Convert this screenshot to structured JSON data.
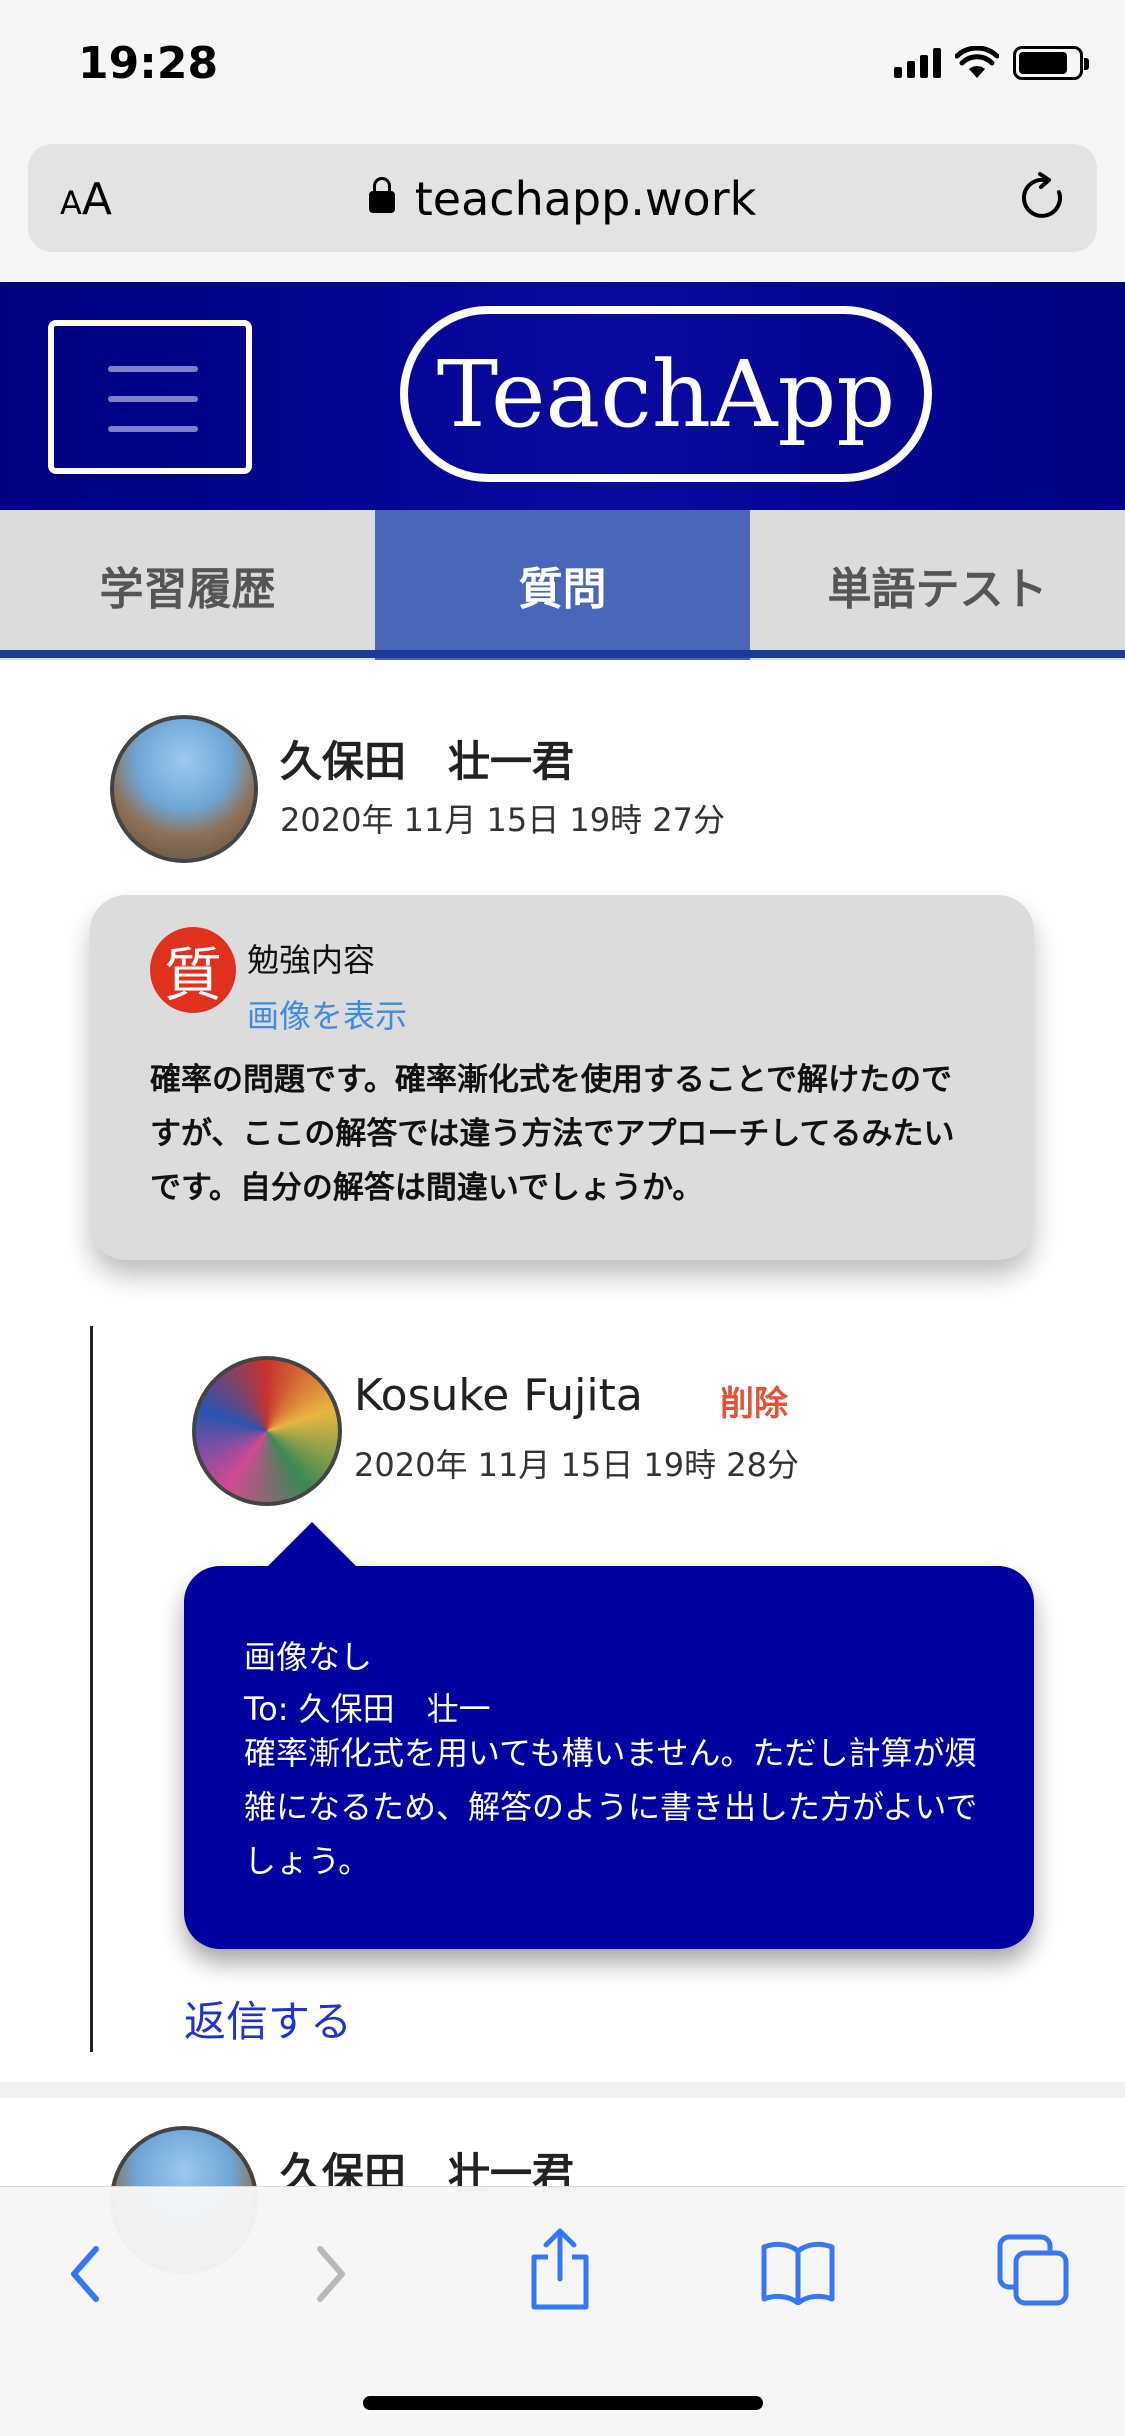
{
  "status_bar": {
    "time": "19:28"
  },
  "browser": {
    "text_size_label": "AA",
    "url": "teachapp.work"
  },
  "header": {
    "logo": "TeachApp"
  },
  "tabs": [
    {
      "label": "学習履歴",
      "active": false
    },
    {
      "label": "質問",
      "active": true
    },
    {
      "label": "単語テスト",
      "active": false
    }
  ],
  "question": {
    "author": "久保田　壮一君",
    "date": "2020年 11月 15日 19時 27分",
    "mark": "質",
    "subject": "勉強内容",
    "image_link": "画像を表示",
    "body": "確率の問題です。確率漸化式を使用することで解けたのですが、ここの解答では違う方法でアプローチしてるみたいです。自分の解答は間違いでしょうか。"
  },
  "reply": {
    "author": "Kosuke Fujita",
    "delete_label": "削除",
    "date": "2020年 11月 15日 19時 28分",
    "image_status": "画像なし",
    "to": "To: 久保田　壮一",
    "body": "確率漸化式を用いても構いません。ただし計算が煩雑になるため、解答のように書き出した方がよいでしょう。",
    "reply_link": "返信する"
  },
  "next_post": {
    "author": "久保田　壮一君"
  },
  "colors": {
    "header_bg": "#00007f",
    "active_tab": "#4a66b8",
    "reply_bubble": "#0000a0",
    "delete_red": "#e0533a",
    "link_blue": "#3e8be0",
    "question_mark_red": "#e0301e"
  },
  "toolbar": {
    "icons": [
      "back-icon",
      "forward-icon",
      "share-icon",
      "bookmarks-icon",
      "tabs-icon"
    ]
  }
}
